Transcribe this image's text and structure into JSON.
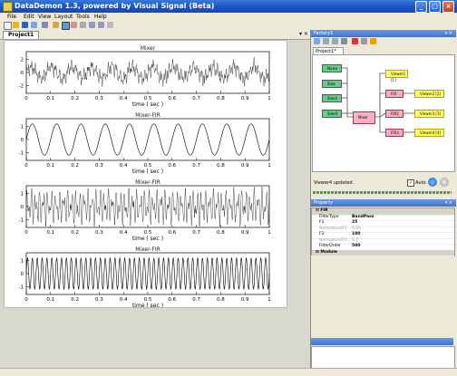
{
  "window": {
    "title": "DataDemon 1.3, powered by Visual Signal (Beta)"
  },
  "menu": {
    "items": [
      "File",
      "Edit",
      "View",
      "Layout",
      "Tools",
      "Help"
    ]
  },
  "doc": {
    "tab": "Project1",
    "controls": "▾ ×"
  },
  "figure": {
    "subplots": [
      {
        "title": "Mixer",
        "xlabel": "time ( sec )",
        "yticks": [
          "2",
          "0",
          "-2"
        ]
      },
      {
        "title": "Mixer-FIR",
        "xlabel": "time ( sec )",
        "yticks": [
          "1",
          "0",
          "-1"
        ]
      },
      {
        "title": "Mixer-FIR",
        "xlabel": "time ( sec )",
        "yticks": [
          "1",
          "0",
          "-1"
        ]
      },
      {
        "title": "Mixer-FIR",
        "xlabel": "time ( sec )",
        "yticks": [
          "1",
          "0",
          "-1"
        ]
      }
    ],
    "xticks": [
      "0",
      "0.1",
      "0.2",
      "0.3",
      "0.4",
      "0.5",
      "0.6",
      "0.7",
      "0.8",
      "0.9",
      "1"
    ]
  },
  "factory": {
    "title": "Factory1",
    "tab": "Project1*",
    "nodes": {
      "sources": [
        "Noise",
        "Sine",
        "Sine2",
        "Sine3"
      ],
      "mixer": "Mixer",
      "filters": [
        "FIR",
        "FIR2",
        "FIR3"
      ],
      "viewers": [
        "Viewer1 [1]",
        "Viewer2 [2]",
        "Viewer3 [3]",
        "Viewer4 [4]"
      ]
    },
    "status": "Viewer4 updated.",
    "auto_label": "Auto"
  },
  "property": {
    "title": "Property",
    "category_fir": "FIR",
    "category_module": "Module",
    "rows": [
      {
        "key": "FilterType",
        "value": "BandPass",
        "dim": false
      },
      {
        "key": "F1",
        "value": "25",
        "dim": false
      },
      {
        "key": "NormalizedF1",
        "value": "0.05",
        "dim": true
      },
      {
        "key": "F2",
        "value": "100",
        "dim": false
      },
      {
        "key": "NormalizedF2",
        "value": "0.2",
        "dim": true
      },
      {
        "key": "FilterOrder",
        "value": "500",
        "dim": false
      }
    ]
  },
  "colors": {
    "titlebar": "#1a55c8",
    "trace": "#000000",
    "nodeGreen": "#66cc88",
    "nodeYellow": "#ffff66",
    "nodePink": "#f6b0c0"
  }
}
